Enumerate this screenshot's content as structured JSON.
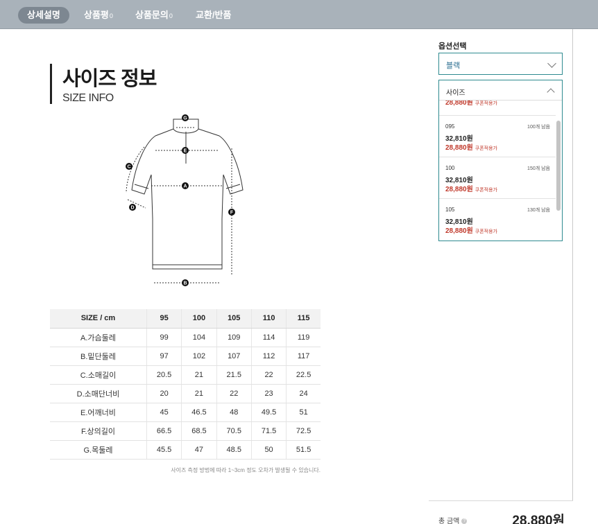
{
  "tabs": [
    {
      "label": "상세설명",
      "count": ""
    },
    {
      "label": "상품평",
      "count": "0"
    },
    {
      "label": "상품문의",
      "count": "0"
    },
    {
      "label": "교환/반품",
      "count": ""
    }
  ],
  "main": {
    "title_ko": "사이즈 정보",
    "title_en": "SIZE INFO",
    "diagram_markers": [
      "G",
      "E",
      "C",
      "A",
      "D",
      "F",
      "B"
    ],
    "note": "사이즈 측정 방법에 따라 1~3cm 정도 오차가 발생될 수 있습니다."
  },
  "size_table": {
    "headers": [
      "SIZE / cm",
      "95",
      "100",
      "105",
      "110",
      "115"
    ],
    "rows": [
      [
        "A.가슴둘레",
        "99",
        "104",
        "109",
        "114",
        "119"
      ],
      [
        "B.밑단둘레",
        "97",
        "102",
        "107",
        "112",
        "117"
      ],
      [
        "C.소매길이",
        "20.5",
        "21",
        "21.5",
        "22",
        "22.5"
      ],
      [
        "D.소매단너비",
        "20",
        "21",
        "22",
        "23",
        "24"
      ],
      [
        "E.어깨너비",
        "45",
        "46.5",
        "48",
        "49.5",
        "51"
      ],
      [
        "F.상의길이",
        "66.5",
        "68.5",
        "70.5",
        "71.5",
        "72.5"
      ],
      [
        "G.목둘레",
        "45.5",
        "47",
        "48.5",
        "50",
        "51.5"
      ]
    ]
  },
  "panel": {
    "option_label": "옵션선택",
    "color_value": "블랙",
    "size_placeholder": "사이즈",
    "partial_sale": "28,880원",
    "coupon_tag": "쿠폰적용가",
    "options": [
      {
        "size": "095",
        "stock": "100개 남음",
        "price": "32,810원",
        "sale": "28,880원"
      },
      {
        "size": "100",
        "stock": "150개 남음",
        "price": "32,810원",
        "sale": "28,880원"
      },
      {
        "size": "105",
        "stock": "130개 남음",
        "price": "32,810원",
        "sale": "28,880원"
      }
    ],
    "total_label": "총 금액",
    "total_value": "28,880원"
  },
  "colors": {
    "tabbar": "#a9b2ba",
    "active_tab": "#7d8791",
    "select_border": "#2d8a8f",
    "sale_red": "#c0392b"
  }
}
